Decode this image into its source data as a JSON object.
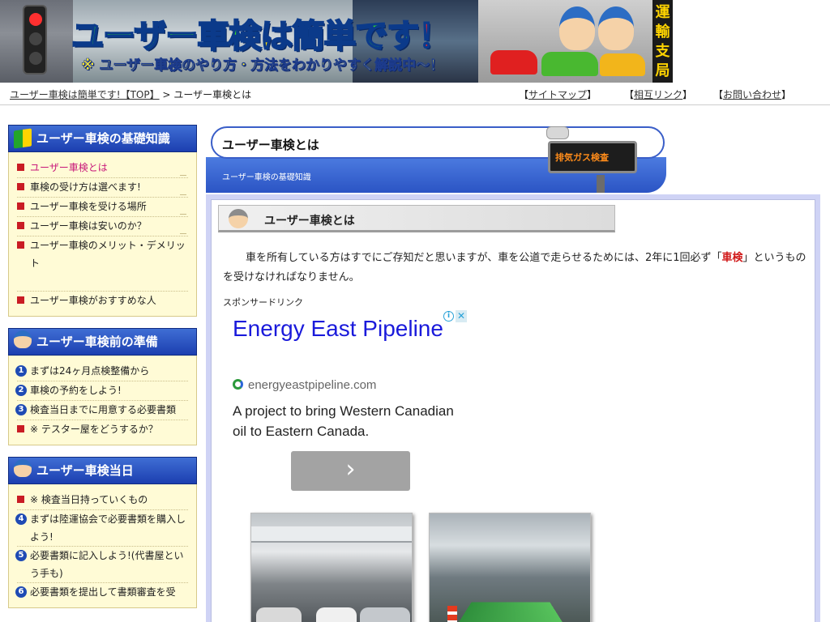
{
  "banner": {
    "title_part1": "ユーザー車検",
    "title_part2": "は",
    "title_part3": "簡単です",
    "title_part4": "！",
    "subtitle": "※ ユーザー車検のやり方・方法をわかりやすく解説中〜！",
    "office_label": [
      "運",
      "輸",
      "支",
      "局"
    ]
  },
  "breadcrumb": {
    "home_link": "ユーザー車検は簡単です!【TOP】",
    "separator": ">",
    "current": "ユーザー車検とは"
  },
  "top_links": [
    {
      "prefix": "【",
      "label": "サイトマップ",
      "suffix": "】"
    },
    {
      "prefix": "【",
      "label": "相互リンク",
      "suffix": "】"
    },
    {
      "prefix": "【",
      "label": "お問い合わせ",
      "suffix": "】"
    }
  ],
  "sidebar": {
    "sections": [
      {
        "title": "ユーザー車検の基礎知識",
        "items": [
          {
            "label": "ユーザー車検とは",
            "active": true
          },
          {
            "label": "車検の受け方は選べます!"
          },
          {
            "label": "ユーザー車検を受ける場所"
          },
          {
            "label": "ユーザー車検は安いのか？"
          },
          {
            "label": "ユーザー車検のメリット・デメリット"
          },
          {
            "label": "ユーザー車検がおすすめな人"
          }
        ]
      },
      {
        "title": "ユーザー車検前の準備",
        "items": [
          {
            "num": "1",
            "label": "まずは24ヶ月点検整備から"
          },
          {
            "num": "2",
            "label": "車検の予約をしよう!"
          },
          {
            "num": "3",
            "label": "検査当日までに用意する必要書類"
          },
          {
            "label": "※ テスター屋をどうするか？"
          }
        ]
      },
      {
        "title": "ユーザー車検当日",
        "items": [
          {
            "label": "※ 検査当日持っていくもの"
          },
          {
            "num": "4",
            "label": "まずは陸運協会で必要書類を購入しよう!"
          },
          {
            "num": "5",
            "label": "必要書類に記入しよう!(代書屋という手も)"
          },
          {
            "num": "6",
            "label": "必要書類を提出して書類審査を受"
          }
        ]
      }
    ]
  },
  "main": {
    "page_title": "ユーザー車検とは",
    "page_subtitle": "ユーザー車検の基礎知識",
    "sign_text": "排気ガス検査",
    "section_title": "ユーザー車検とは",
    "intro_before": "車を所有している方はすでにご存知だと思いますが、車を公道で走らせるためには、2年に1回必ず「",
    "intro_highlight": "車検",
    "intro_after": "」というものを受けなければなりません。",
    "sponsor_label": "スポンサードリンク"
  },
  "ad": {
    "headline": "Energy East Pipeline",
    "domain": "energyeastpipeline.com",
    "body": "A project to bring Western Canadian oil to Eastern Canada.",
    "button_glyph": "›",
    "adchoices_info": "i",
    "adchoices_close": "✕"
  },
  "colors": {
    "nav_blue": "#1c3fb0",
    "sidebar_bg": "#fffbd6",
    "active_item": "#c8187a",
    "highlight_red": "#d01818",
    "ad_headline": "#1a1adb"
  }
}
